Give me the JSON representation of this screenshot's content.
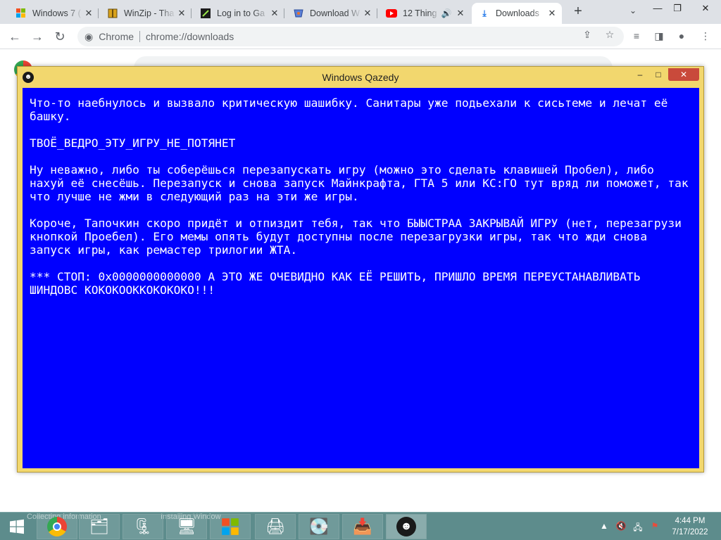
{
  "browser": {
    "tabs": [
      {
        "title": "Windows 7 (",
        "icon": "windows-flag-icon",
        "active": false
      },
      {
        "title": "WinZip - Tha",
        "icon": "winzip-icon",
        "active": false
      },
      {
        "title": "Log in to Ga",
        "icon": "game-icon",
        "active": false
      },
      {
        "title": "Download W",
        "icon": "download-site-icon",
        "active": false
      },
      {
        "title": "12 Thing",
        "icon": "youtube-icon",
        "active": false,
        "audio": true
      },
      {
        "title": "Downloads",
        "icon": "download-icon",
        "active": true
      }
    ],
    "omnibox": {
      "chip": "Chrome",
      "url": "chrome://downloads"
    }
  },
  "app_window": {
    "title": "Windows Qazedy",
    "bsod_paragraphs": [
      "Что-то наебнулось и вызвало критическую шашибку. Санитары уже подьехали к сисьтеме и лечат её башку.",
      "ТВОЁ_ВЕДРО_ЭТУ_ИГРУ_НЕ_ПОТЯНЕТ",
      "Ну неважно, либо ты соберёшься перезапускать игру (можно это сделать клавишей Пробел), либо нахуй её снесёшь. Перезапуск и снова запуск Майнкрафта, ГТА 5 или КС:ГО тут вряд ли поможет, так что лучше не жми в следующий раз на эти же игры.",
      "Короче, Тапочкин скоро придёт и отпиздит тебя, так что БЫЫСТРАА ЗАКРЫВАЙ ИГРУ (нет, перезагрузи кнопкой Проебел). Его мемы опять будут доступны после перезагрузки игры, так что жди снова запуск игры, как ремастер трилогии ЖТА.",
      "*** СТОП: 0x0000000000000 А ЭТО ЖЕ ОЧЕВИДНО КАК ЕЁ РЕШИТЬ, ПРИШЛО ВРЕМЯ ПЕРЕУСТАНАВЛИВАТЬ ШИНДОВС КОКОКООККОКОКОКО!!!"
    ]
  },
  "taskbar": {
    "ghost_text_1": "Collecting information",
    "ghost_text_2": "Installing Window",
    "buttons": [
      "chrome-icon",
      "file-explorer-icon",
      "archive-icon",
      "installer-icon",
      "windows-logo-icon",
      "system-tool-icon",
      "setup-disk-icon",
      "downloader-icon",
      "qazedy-icon"
    ],
    "clock": {
      "time": "4:44 PM",
      "date": "7/17/2022"
    }
  },
  "colors": {
    "bsod_blue": "#0000ff",
    "window_frame": "#f2d76e",
    "taskbar": "#5d8c8c",
    "close_red": "#c94a3b"
  }
}
